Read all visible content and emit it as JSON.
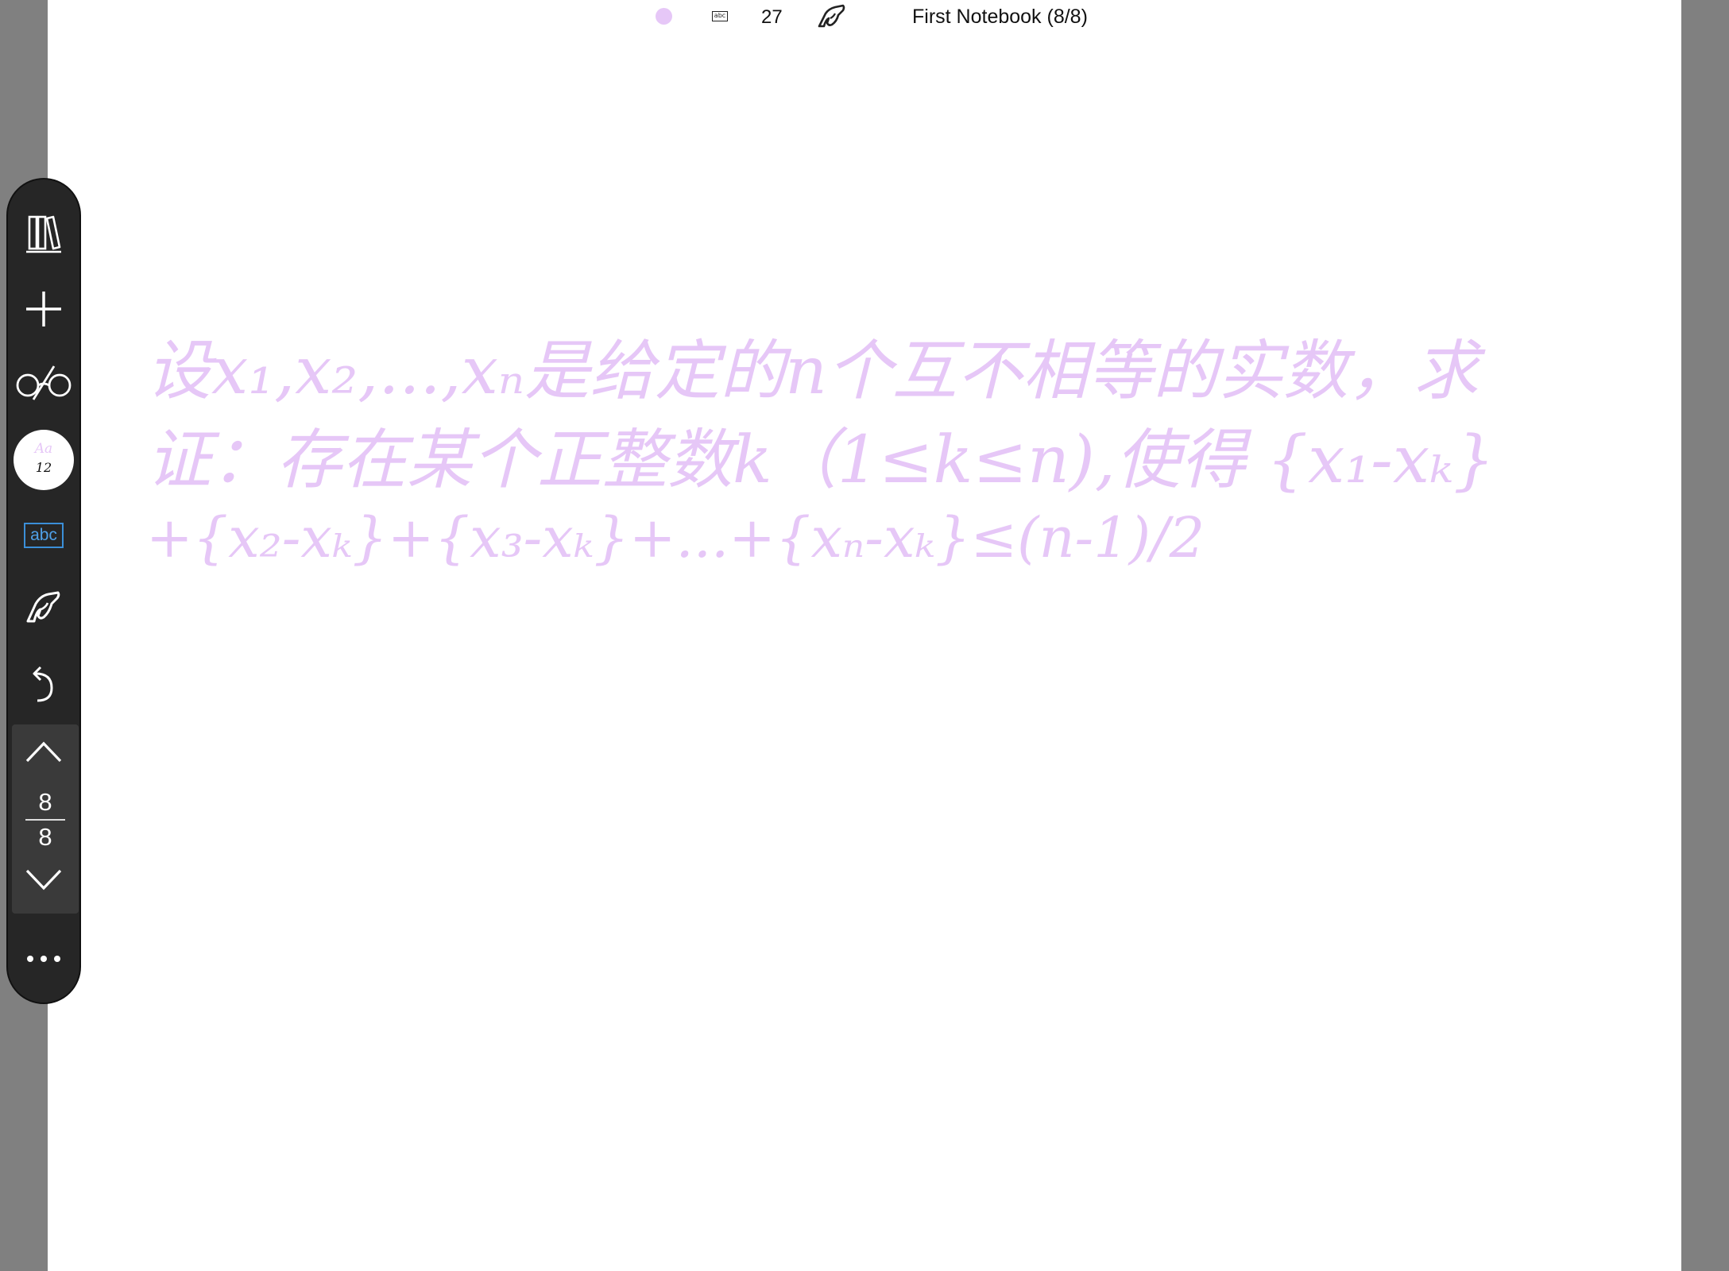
{
  "status_bar": {
    "ink_color": "#e6c7f7",
    "text_mode_icon_label": "abc",
    "pen_size": "27",
    "notebook_title": "First Notebook (8/8)"
  },
  "toolbar": {
    "pen_preview_label": "Aa",
    "pen_preview_size": "12",
    "text_button_label": "abc",
    "current_page": "8",
    "total_pages": "8",
    "accent_color": "#3b8fd8"
  },
  "page_content": {
    "line1": "设x₁,x₂,...,xₙ是给定的n个互不相等的实数，求",
    "line2": "证：存在某个正整数k（1≤k≤n),使得 {x₁-xₖ}",
    "line3": "+{x₂-xₖ}+{x₃-xₖ}+...+{xₙ-xₖ}≤(n-1)/2"
  }
}
